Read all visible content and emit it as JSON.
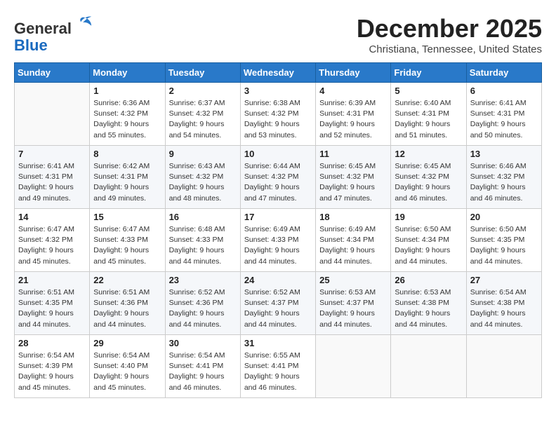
{
  "header": {
    "logo_line1": "General",
    "logo_line2": "Blue",
    "month": "December 2025",
    "location": "Christiana, Tennessee, United States"
  },
  "days_of_week": [
    "Sunday",
    "Monday",
    "Tuesday",
    "Wednesday",
    "Thursday",
    "Friday",
    "Saturday"
  ],
  "weeks": [
    [
      {
        "day": "",
        "sunrise": "",
        "sunset": "",
        "daylight": ""
      },
      {
        "day": "1",
        "sunrise": "Sunrise: 6:36 AM",
        "sunset": "Sunset: 4:32 PM",
        "daylight": "Daylight: 9 hours and 55 minutes."
      },
      {
        "day": "2",
        "sunrise": "Sunrise: 6:37 AM",
        "sunset": "Sunset: 4:32 PM",
        "daylight": "Daylight: 9 hours and 54 minutes."
      },
      {
        "day": "3",
        "sunrise": "Sunrise: 6:38 AM",
        "sunset": "Sunset: 4:32 PM",
        "daylight": "Daylight: 9 hours and 53 minutes."
      },
      {
        "day": "4",
        "sunrise": "Sunrise: 6:39 AM",
        "sunset": "Sunset: 4:31 PM",
        "daylight": "Daylight: 9 hours and 52 minutes."
      },
      {
        "day": "5",
        "sunrise": "Sunrise: 6:40 AM",
        "sunset": "Sunset: 4:31 PM",
        "daylight": "Daylight: 9 hours and 51 minutes."
      },
      {
        "day": "6",
        "sunrise": "Sunrise: 6:41 AM",
        "sunset": "Sunset: 4:31 PM",
        "daylight": "Daylight: 9 hours and 50 minutes."
      }
    ],
    [
      {
        "day": "7",
        "sunrise": "Sunrise: 6:41 AM",
        "sunset": "Sunset: 4:31 PM",
        "daylight": "Daylight: 9 hours and 49 minutes."
      },
      {
        "day": "8",
        "sunrise": "Sunrise: 6:42 AM",
        "sunset": "Sunset: 4:31 PM",
        "daylight": "Daylight: 9 hours and 49 minutes."
      },
      {
        "day": "9",
        "sunrise": "Sunrise: 6:43 AM",
        "sunset": "Sunset: 4:32 PM",
        "daylight": "Daylight: 9 hours and 48 minutes."
      },
      {
        "day": "10",
        "sunrise": "Sunrise: 6:44 AM",
        "sunset": "Sunset: 4:32 PM",
        "daylight": "Daylight: 9 hours and 47 minutes."
      },
      {
        "day": "11",
        "sunrise": "Sunrise: 6:45 AM",
        "sunset": "Sunset: 4:32 PM",
        "daylight": "Daylight: 9 hours and 47 minutes."
      },
      {
        "day": "12",
        "sunrise": "Sunrise: 6:45 AM",
        "sunset": "Sunset: 4:32 PM",
        "daylight": "Daylight: 9 hours and 46 minutes."
      },
      {
        "day": "13",
        "sunrise": "Sunrise: 6:46 AM",
        "sunset": "Sunset: 4:32 PM",
        "daylight": "Daylight: 9 hours and 46 minutes."
      }
    ],
    [
      {
        "day": "14",
        "sunrise": "Sunrise: 6:47 AM",
        "sunset": "Sunset: 4:32 PM",
        "daylight": "Daylight: 9 hours and 45 minutes."
      },
      {
        "day": "15",
        "sunrise": "Sunrise: 6:47 AM",
        "sunset": "Sunset: 4:33 PM",
        "daylight": "Daylight: 9 hours and 45 minutes."
      },
      {
        "day": "16",
        "sunrise": "Sunrise: 6:48 AM",
        "sunset": "Sunset: 4:33 PM",
        "daylight": "Daylight: 9 hours and 44 minutes."
      },
      {
        "day": "17",
        "sunrise": "Sunrise: 6:49 AM",
        "sunset": "Sunset: 4:33 PM",
        "daylight": "Daylight: 9 hours and 44 minutes."
      },
      {
        "day": "18",
        "sunrise": "Sunrise: 6:49 AM",
        "sunset": "Sunset: 4:34 PM",
        "daylight": "Daylight: 9 hours and 44 minutes."
      },
      {
        "day": "19",
        "sunrise": "Sunrise: 6:50 AM",
        "sunset": "Sunset: 4:34 PM",
        "daylight": "Daylight: 9 hours and 44 minutes."
      },
      {
        "day": "20",
        "sunrise": "Sunrise: 6:50 AM",
        "sunset": "Sunset: 4:35 PM",
        "daylight": "Daylight: 9 hours and 44 minutes."
      }
    ],
    [
      {
        "day": "21",
        "sunrise": "Sunrise: 6:51 AM",
        "sunset": "Sunset: 4:35 PM",
        "daylight": "Daylight: 9 hours and 44 minutes."
      },
      {
        "day": "22",
        "sunrise": "Sunrise: 6:51 AM",
        "sunset": "Sunset: 4:36 PM",
        "daylight": "Daylight: 9 hours and 44 minutes."
      },
      {
        "day": "23",
        "sunrise": "Sunrise: 6:52 AM",
        "sunset": "Sunset: 4:36 PM",
        "daylight": "Daylight: 9 hours and 44 minutes."
      },
      {
        "day": "24",
        "sunrise": "Sunrise: 6:52 AM",
        "sunset": "Sunset: 4:37 PM",
        "daylight": "Daylight: 9 hours and 44 minutes."
      },
      {
        "day": "25",
        "sunrise": "Sunrise: 6:53 AM",
        "sunset": "Sunset: 4:37 PM",
        "daylight": "Daylight: 9 hours and 44 minutes."
      },
      {
        "day": "26",
        "sunrise": "Sunrise: 6:53 AM",
        "sunset": "Sunset: 4:38 PM",
        "daylight": "Daylight: 9 hours and 44 minutes."
      },
      {
        "day": "27",
        "sunrise": "Sunrise: 6:54 AM",
        "sunset": "Sunset: 4:38 PM",
        "daylight": "Daylight: 9 hours and 44 minutes."
      }
    ],
    [
      {
        "day": "28",
        "sunrise": "Sunrise: 6:54 AM",
        "sunset": "Sunset: 4:39 PM",
        "daylight": "Daylight: 9 hours and 45 minutes."
      },
      {
        "day": "29",
        "sunrise": "Sunrise: 6:54 AM",
        "sunset": "Sunset: 4:40 PM",
        "daylight": "Daylight: 9 hours and 45 minutes."
      },
      {
        "day": "30",
        "sunrise": "Sunrise: 6:54 AM",
        "sunset": "Sunset: 4:41 PM",
        "daylight": "Daylight: 9 hours and 46 minutes."
      },
      {
        "day": "31",
        "sunrise": "Sunrise: 6:55 AM",
        "sunset": "Sunset: 4:41 PM",
        "daylight": "Daylight: 9 hours and 46 minutes."
      },
      {
        "day": "",
        "sunrise": "",
        "sunset": "",
        "daylight": ""
      },
      {
        "day": "",
        "sunrise": "",
        "sunset": "",
        "daylight": ""
      },
      {
        "day": "",
        "sunrise": "",
        "sunset": "",
        "daylight": ""
      }
    ]
  ]
}
